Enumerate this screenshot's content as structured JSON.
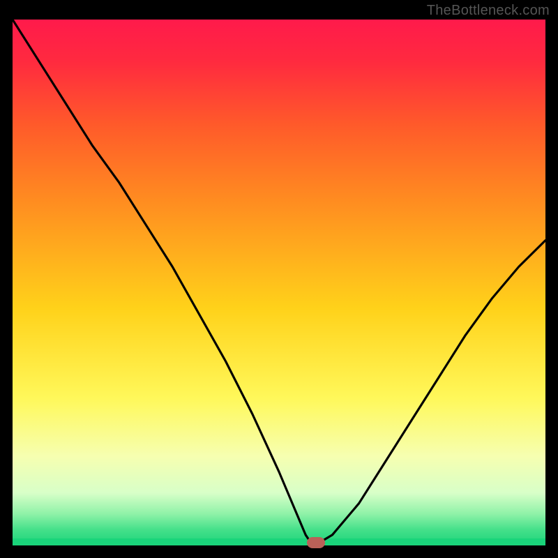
{
  "watermark": "TheBottleneck.com",
  "chart_data": {
    "type": "line",
    "title": "",
    "xlabel": "",
    "ylabel": "",
    "xlim": [
      0,
      100
    ],
    "ylim": [
      0,
      100
    ],
    "x": [
      0,
      5,
      10,
      15,
      20,
      25,
      30,
      35,
      40,
      45,
      50,
      55,
      56,
      57,
      58,
      60,
      65,
      70,
      75,
      80,
      85,
      90,
      95,
      100
    ],
    "values": [
      100,
      92,
      84,
      76,
      69,
      61,
      53,
      44,
      35,
      25,
      14,
      2,
      0.5,
      0.5,
      0.8,
      2,
      8,
      16,
      24,
      32,
      40,
      47,
      53,
      58
    ],
    "gradient_stops": [
      {
        "offset": 0.0,
        "color": "#ff1a4b"
      },
      {
        "offset": 0.08,
        "color": "#ff2a3f"
      },
      {
        "offset": 0.2,
        "color": "#ff5a2a"
      },
      {
        "offset": 0.35,
        "color": "#ff8e20"
      },
      {
        "offset": 0.55,
        "color": "#ffd21a"
      },
      {
        "offset": 0.72,
        "color": "#fff85a"
      },
      {
        "offset": 0.83,
        "color": "#f6ffb0"
      },
      {
        "offset": 0.9,
        "color": "#d8ffc8"
      },
      {
        "offset": 0.94,
        "color": "#8ff2a8"
      },
      {
        "offset": 0.97,
        "color": "#45e08a"
      },
      {
        "offset": 1.0,
        "color": "#1ad47a"
      }
    ],
    "bottom_band_color": "#1ad47a",
    "marker": {
      "x": 57,
      "y": 0.5,
      "color": "#b96158"
    },
    "curve_color": "#000000",
    "curve_width": 3.2
  }
}
